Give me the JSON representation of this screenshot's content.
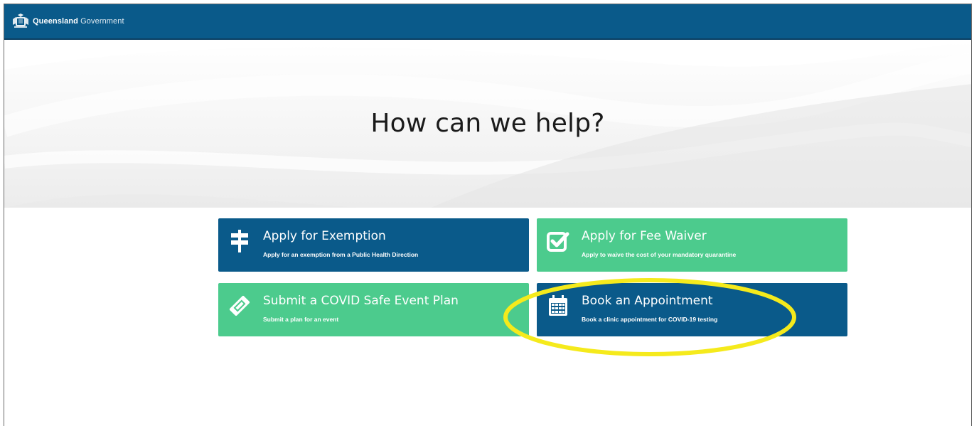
{
  "header": {
    "brand_bold": "Queensland",
    "brand_light": "Government"
  },
  "hero": {
    "title": "How can we help?"
  },
  "tiles": [
    {
      "title": "Apply for Exemption",
      "subtitle": "Apply for an exemption from a Public Health Direction",
      "icon": "signpost-icon",
      "color": "#0a5a8a"
    },
    {
      "title": "Apply for Fee Waiver",
      "subtitle": "Apply to waive the cost of your mandatory quarantine",
      "icon": "checkbox-icon",
      "color": "#4ccb8d"
    },
    {
      "title": "Submit a COVID Safe Event Plan",
      "subtitle": "Submit a plan for an event",
      "icon": "ticket-icon",
      "color": "#4ccb8d"
    },
    {
      "title": "Book an Appointment",
      "subtitle": "Book a clinic appointment for COVID-19 testing",
      "icon": "calendar-icon",
      "color": "#0a5a8a"
    }
  ],
  "annotation": {
    "highlight_color": "#f5ea1c",
    "highlighted_tile": "Book an Appointment"
  }
}
